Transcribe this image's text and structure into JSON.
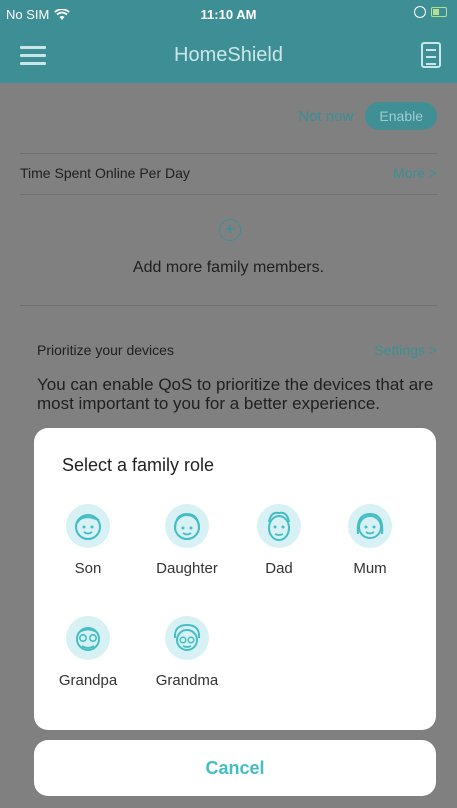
{
  "status_bar": {
    "carrier": "No SIM",
    "time": "11:10 AM"
  },
  "header": {
    "title": "HomeShield"
  },
  "background": {
    "not_now_label": "Not now",
    "enable_label": "Enable",
    "time_online_label": "Time Spent Online Per Day",
    "more_label": "More >",
    "add_members_label": "Add more family members.",
    "prioritize_title": "Prioritize your devices",
    "settings_label": "Settings >",
    "prioritize_desc": "You can enable QoS to prioritize the devices that are most important to you for a better experience."
  },
  "role_sheet": {
    "title": "Select a family role",
    "roles": [
      {
        "label": "Son",
        "icon": "son-face-icon"
      },
      {
        "label": "Daughter",
        "icon": "daughter-face-icon"
      },
      {
        "label": "Dad",
        "icon": "dad-face-icon"
      },
      {
        "label": "Mum",
        "icon": "mum-face-icon"
      },
      {
        "label": "Grandpa",
        "icon": "grandpa-face-icon"
      },
      {
        "label": "Grandma",
        "icon": "grandma-face-icon"
      }
    ]
  },
  "cancel_label": "Cancel",
  "colors": {
    "accent": "#44bdc4",
    "header": "#3d8f95",
    "overlay": "#808080"
  }
}
